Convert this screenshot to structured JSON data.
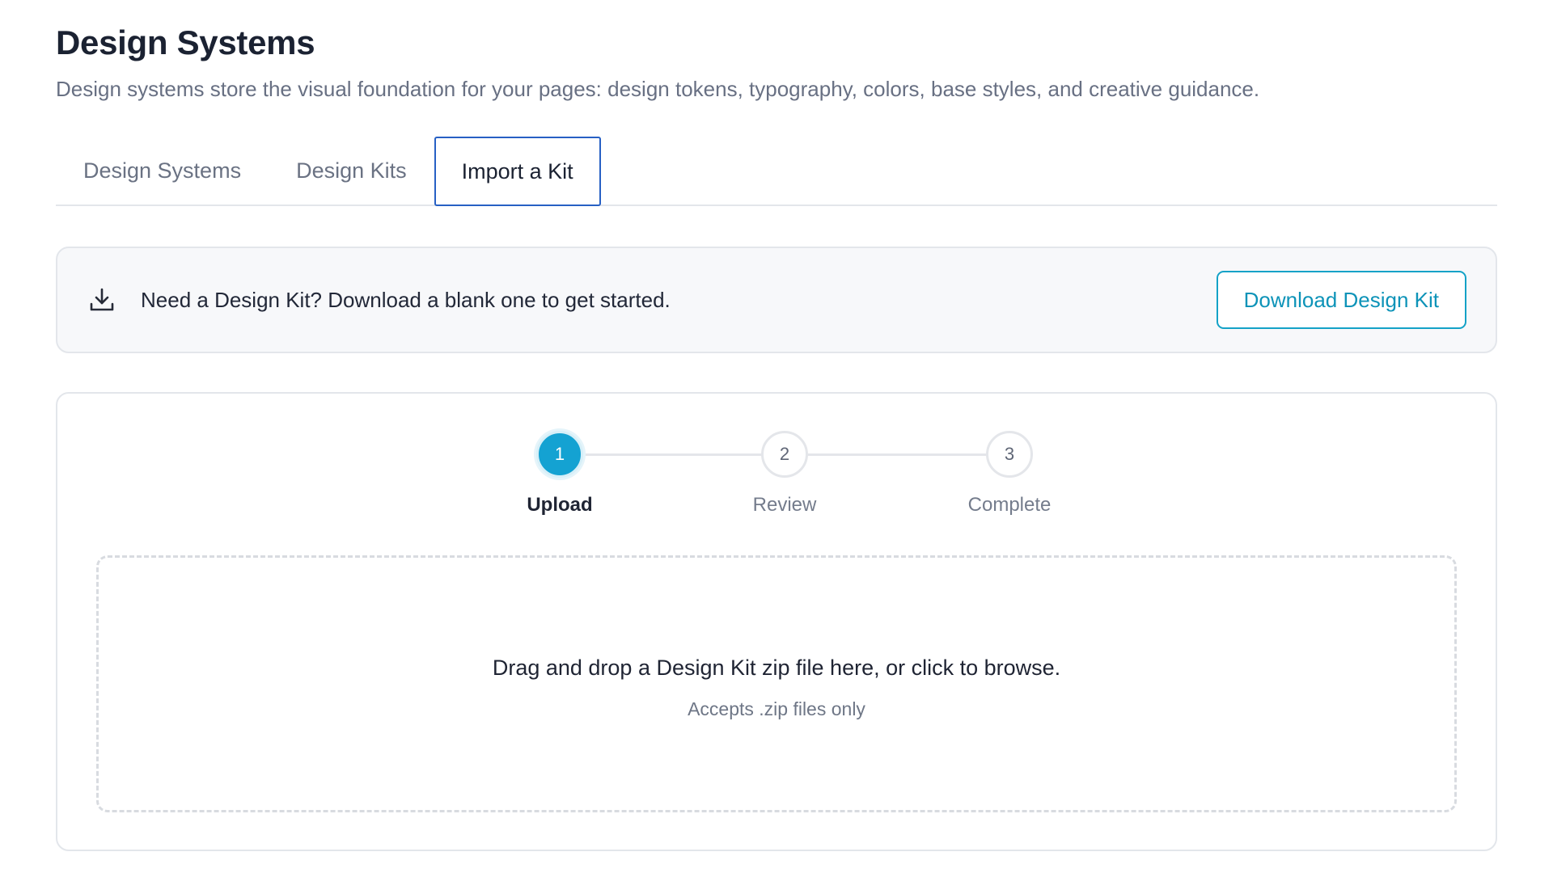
{
  "header": {
    "title": "Design Systems",
    "description": "Design systems store the visual foundation for your pages: design tokens, typography, colors, base styles, and creative guidance."
  },
  "tabs": [
    {
      "label": "Design Systems",
      "active": false
    },
    {
      "label": "Design Kits",
      "active": false
    },
    {
      "label": "Import a Kit",
      "active": true
    }
  ],
  "banner": {
    "icon": "download-icon",
    "text": "Need a Design Kit? Download a blank one to get started.",
    "button_label": "Download Design Kit"
  },
  "stepper": {
    "steps": [
      {
        "number": "1",
        "label": "Upload",
        "active": true
      },
      {
        "number": "2",
        "label": "Review",
        "active": false
      },
      {
        "number": "3",
        "label": "Complete",
        "active": false
      }
    ]
  },
  "dropzone": {
    "main_text": "Drag and drop a Design Kit zip file here, or click to browse.",
    "sub_text": "Accepts .zip files only"
  },
  "colors": {
    "accent": "#14a2d2",
    "tab_focus": "#2760c4",
    "text_primary": "#1b2232",
    "text_muted": "#687083"
  }
}
